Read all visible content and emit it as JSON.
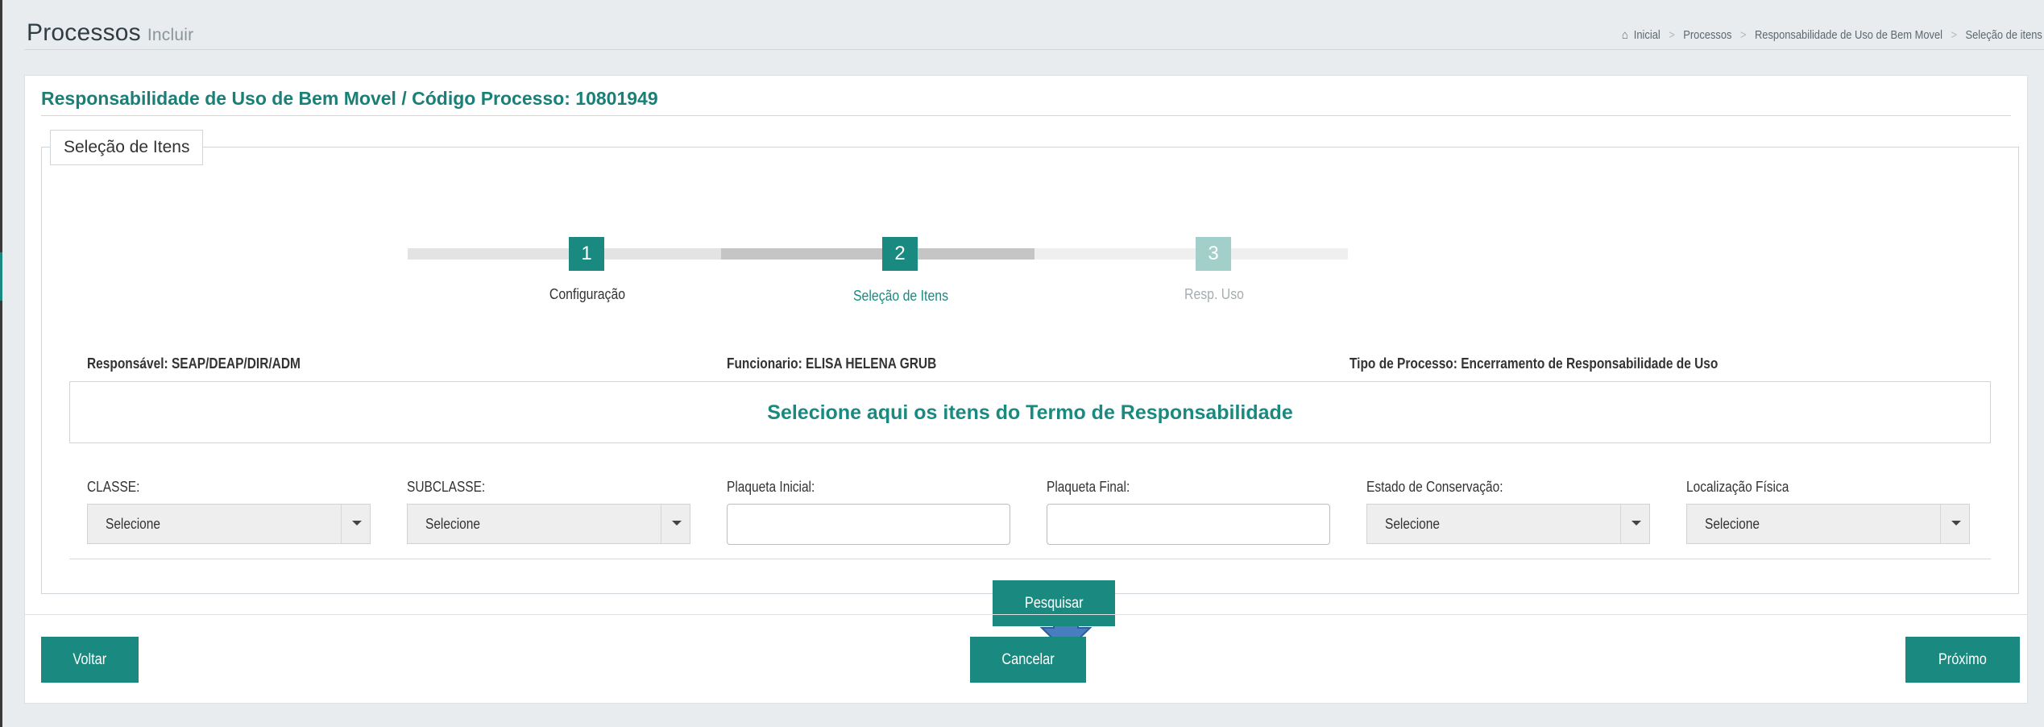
{
  "header": {
    "title": "Processos",
    "subtitle": "Incluir",
    "breadcrumb": [
      "Inicial",
      "Processos",
      "Responsabilidade de Uso de Bem Movel",
      "Seleção de itens"
    ]
  },
  "panel": {
    "title": "Responsabilidade de Uso de Bem Movel / Código Processo: 10801949",
    "legend": "Seleção de Itens"
  },
  "wizard": {
    "steps": [
      {
        "number": "1",
        "label": "Configuração",
        "state": "completed"
      },
      {
        "number": "2",
        "label": "Seleção de Itens",
        "state": "active"
      },
      {
        "number": "3",
        "label": "Resp. Uso",
        "state": "pending"
      }
    ]
  },
  "info": {
    "responsavel": "Responsável: SEAP/DEAP/DIR/ADM",
    "funcionario": "Funcionario: ELISA HELENA GRUB",
    "tipo_processo": "Tipo de Processo: Encerramento de Responsabilidade de Uso"
  },
  "banner": "Selecione aqui os itens do Termo de Responsabilidade",
  "filters": {
    "classe": {
      "label": "CLASSE:",
      "value": "Selecione"
    },
    "subclasse": {
      "label": "SUBCLASSE:",
      "value": "Selecione"
    },
    "plaqueta_inicial": {
      "label": "Plaqueta Inicial:",
      "value": ""
    },
    "plaqueta_final": {
      "label": "Plaqueta Final:",
      "value": ""
    },
    "estado_conservacao": {
      "label": "Estado de Conservação:",
      "value": "Selecione"
    },
    "localizacao_fisica": {
      "label": "Localização Física",
      "value": "Selecione"
    }
  },
  "buttons": {
    "pesquisar": "Pesquisar",
    "voltar": "Voltar",
    "cancelar": "Cancelar",
    "proximo": "Próximo"
  },
  "colors": {
    "accent": "#1a8a80",
    "accent_light": "#a3cfcb",
    "arrow": "#4a7cc0"
  },
  "icons": {
    "home": "home-icon",
    "dropdown": "chevron-down-icon",
    "pointer": "down-arrow-icon"
  }
}
